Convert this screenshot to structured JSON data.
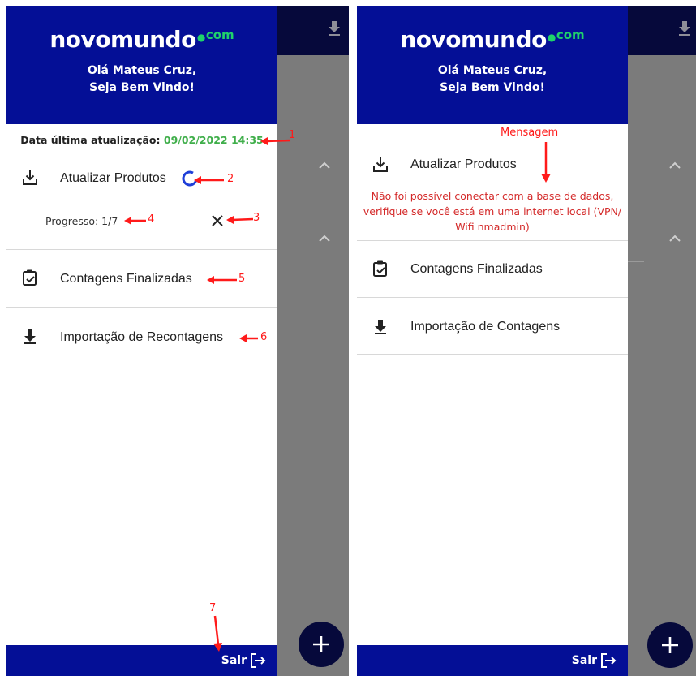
{
  "brand": {
    "name": "novomundo",
    "suffix": "com",
    "accent": "#1fd36b",
    "primary": "#040f96"
  },
  "greeting": {
    "line1": "Olá Mateus Cruz,",
    "line2": "Seja Bem Vindo!"
  },
  "left": {
    "last_update_label": "Data última atualização:",
    "last_update_value": "09/02/2022 14:35",
    "menu": [
      {
        "label": "Atualizar Produtos",
        "icon": "download-tray-icon"
      },
      {
        "label": "Contagens Finalizadas",
        "icon": "clipboard-check-icon"
      },
      {
        "label": "Importação de Recontagens",
        "icon": "download-icon"
      }
    ],
    "progress": "Progresso: 1/7",
    "annotations": [
      "1",
      "2",
      "3",
      "4",
      "5",
      "6",
      "7"
    ]
  },
  "right": {
    "annotation_title": "Mensagem",
    "error_message": [
      "Não foi possível conectar com a base de dados,",
      "verifique se você está em uma internet local (VPN/",
      "Wifi nmadmin)"
    ],
    "menu": [
      {
        "label": "Atualizar Produtos",
        "icon": "download-tray-icon"
      },
      {
        "label": "Contagens Finalizadas",
        "icon": "clipboard-check-icon"
      },
      {
        "label": "Importação de Contagens",
        "icon": "download-icon"
      }
    ]
  },
  "footer": {
    "logout_label": "Sair"
  },
  "fab": {
    "label": "+"
  }
}
